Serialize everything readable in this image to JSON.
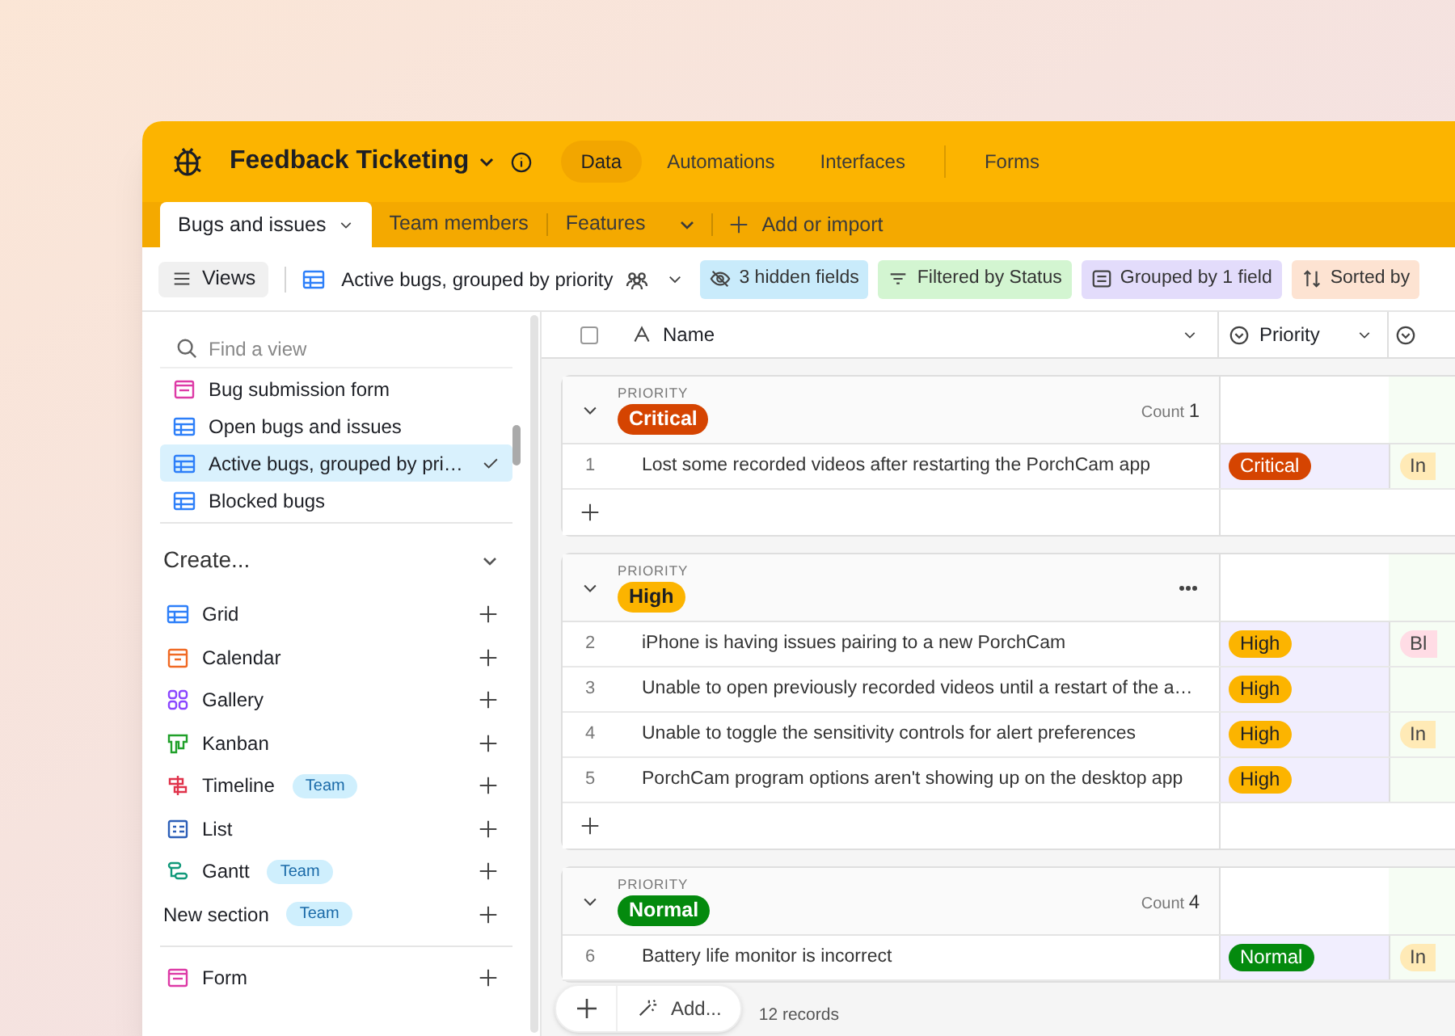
{
  "app": {
    "title": "Feedback Ticketing",
    "nav": [
      {
        "label": "Data",
        "selected": true
      },
      {
        "label": "Automations",
        "selected": false
      },
      {
        "label": "Interfaces",
        "selected": false
      },
      {
        "label": "Forms",
        "selected": false
      }
    ]
  },
  "tables": [
    {
      "label": "Bugs and issues",
      "selected": true
    },
    {
      "label": "Team members",
      "selected": false
    },
    {
      "label": "Features",
      "selected": false
    }
  ],
  "add_table": "Add or import",
  "toolbar": {
    "views_button": "Views",
    "current_view": "Active bugs, grouped by priority",
    "chips": [
      {
        "label": "3 hidden fields",
        "kind": "hide",
        "color": "#c9ebfb"
      },
      {
        "label": "Filtered by Status",
        "kind": "filter",
        "color": "#d3f5d1"
      },
      {
        "label": "Grouped by 1 field",
        "kind": "group",
        "color": "#e3dcfb"
      },
      {
        "label": "Sorted by",
        "kind": "sort",
        "color": "#fde3d2"
      }
    ]
  },
  "sidebar": {
    "search_placeholder": "Find a view",
    "views": [
      {
        "label": "Bug submission form",
        "kind": "form",
        "selected": false
      },
      {
        "label": "Open bugs and issues",
        "kind": "grid",
        "selected": false
      },
      {
        "label": "Active bugs, grouped by pri…",
        "kind": "grid",
        "selected": true
      },
      {
        "label": "Blocked bugs",
        "kind": "grid",
        "selected": false
      }
    ],
    "create": {
      "title": "Create...",
      "items": [
        {
          "label": "Grid",
          "kind": "grid"
        },
        {
          "label": "Calendar",
          "kind": "calendar"
        },
        {
          "label": "Gallery",
          "kind": "gallery"
        },
        {
          "label": "Kanban",
          "kind": "kanban"
        },
        {
          "label": "Timeline",
          "kind": "timeline",
          "badge": "Team"
        },
        {
          "label": "List",
          "kind": "list"
        },
        {
          "label": "Gantt",
          "kind": "gantt",
          "badge": "Team"
        },
        {
          "label": "New section",
          "kind": "section",
          "badge": "Team"
        },
        {
          "label": "Form",
          "kind": "form"
        }
      ]
    }
  },
  "grid": {
    "select_all": {
      "checked": false
    },
    "columns": [
      {
        "label": "Name"
      },
      {
        "label": "Priority"
      }
    ],
    "groups": [
      {
        "field": "PRIORITY",
        "value": "Critical",
        "color": "#d54401",
        "hovered": false,
        "count_label": "Count",
        "count": "1",
        "rows": [
          {
            "number": "1",
            "name": "Lost some recorded videos after restarting the PorchCam app",
            "priority": "Critical",
            "column_3": {
              "text": "In",
              "color": "#ffeab6"
            }
          }
        ]
      },
      {
        "field": "PRIORITY",
        "value": "High",
        "color": "#fcb400",
        "hovered": true,
        "rows": [
          {
            "number": "2",
            "name": "iPhone is having issues pairing to a new PorchCam",
            "priority": "High",
            "column_3": {
              "text": "Bl",
              "color": "#ffdce5"
            }
          },
          {
            "number": "3",
            "name": "Unable to open previously recorded videos until a restart of the a…",
            "priority": "High"
          },
          {
            "number": "4",
            "name": "Unable to toggle the sensitivity controls for alert preferences",
            "priority": "High",
            "column_3": {
              "text": "In",
              "color": "#ffeab6"
            }
          },
          {
            "number": "5",
            "name": "PorchCam program options aren't showing up on the desktop app",
            "priority": "High"
          }
        ]
      },
      {
        "field": "PRIORITY",
        "value": "Normal",
        "color": "#048a0e",
        "hovered": false,
        "count_label": "Count",
        "count": "4",
        "rows": [
          {
            "number": "6",
            "name": "Battery life monitor is incorrect",
            "priority": "Normal",
            "column_3": {
              "text": "In",
              "color": "#ffeab6"
            }
          }
        ]
      }
    ]
  },
  "footer": {
    "add_label": "Add...",
    "records": "12 records"
  }
}
